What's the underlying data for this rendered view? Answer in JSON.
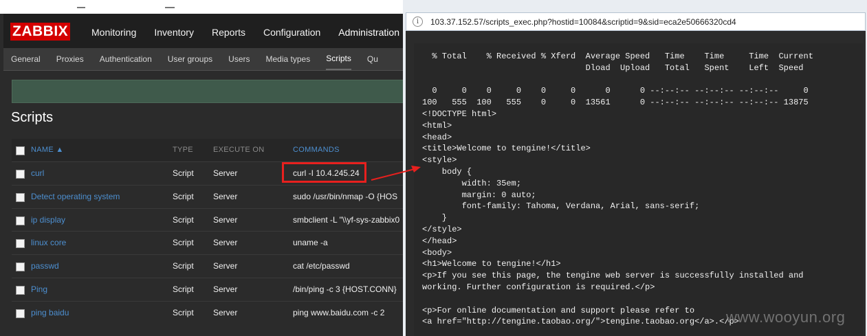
{
  "zabbix": {
    "logo": "ZABBIX",
    "top_nav": [
      "Monitoring",
      "Inventory",
      "Reports",
      "Configuration",
      "Administration"
    ],
    "top_nav_active": "Administration",
    "sub_nav": [
      "General",
      "Proxies",
      "Authentication",
      "User groups",
      "Users",
      "Media types",
      "Scripts",
      "Qu"
    ],
    "sub_nav_active": "Scripts",
    "page_title": "Scripts",
    "table": {
      "headers": {
        "name": "NAME ▲",
        "type": "TYPE",
        "execute_on": "EXECUTE ON",
        "commands": "COMMANDS"
      },
      "rows": [
        {
          "name": "curl",
          "type": "Script",
          "execute_on": "Server",
          "command": "curl -I 10.4.245.24"
        },
        {
          "name": "Detect operating system",
          "type": "Script",
          "execute_on": "Server",
          "command": "sudo /usr/bin/nmap -O {HOS"
        },
        {
          "name": "ip display",
          "type": "Script",
          "execute_on": "Server",
          "command": "smbclient -L \"\\\\yf-sys-zabbix0"
        },
        {
          "name": "linux core",
          "type": "Script",
          "execute_on": "Server",
          "command": "uname -a"
        },
        {
          "name": "passwd",
          "type": "Script",
          "execute_on": "Server",
          "command": "cat /etc/passwd"
        },
        {
          "name": "Ping",
          "type": "Script",
          "execute_on": "Server",
          "command": "/bin/ping -c 3 {HOST.CONN}"
        },
        {
          "name": "ping baidu",
          "type": "Script",
          "execute_on": "Server",
          "command": "ping www.baidu.com -c 2"
        }
      ]
    }
  },
  "browser": {
    "url": "103.37.152.57/scripts_exec.php?hostid=10084&scriptid=9&sid=eca2e50666320cd4",
    "info_icon": "i"
  },
  "output": {
    "lines": [
      "  % Total    % Received % Xferd  Average Speed   Time    Time     Time  Current",
      "                                 Dload  Upload   Total   Spent    Left  Speed",
      "",
      "  0     0    0     0    0     0      0      0 --:--:-- --:--:-- --:--:--     0",
      "100   555  100   555    0     0  13561      0 --:--:-- --:--:-- --:--:-- 13875",
      "<!DOCTYPE html>",
      "<html>",
      "<head>",
      "<title>Welcome to tengine!</title>",
      "<style>",
      "    body {",
      "        width: 35em;",
      "        margin: 0 auto;",
      "        font-family: Tahoma, Verdana, Arial, sans-serif;",
      "    }",
      "</style>",
      "</head>",
      "<body>",
      "<h1>Welcome to tengine!</h1>",
      "<p>If you see this page, the tengine web server is successfully installed and",
      "working. Further configuration is required.</p>",
      "",
      "<p>For online documentation and support please refer to",
      "<a href=\"http://tengine.taobao.org/\">tengine.taobao.org</a>.</p>"
    ]
  },
  "watermark": "www.wooyun.org",
  "colors": {
    "highlight": "#e8201e",
    "link": "#4d8fd0",
    "logo": "#d40000"
  }
}
